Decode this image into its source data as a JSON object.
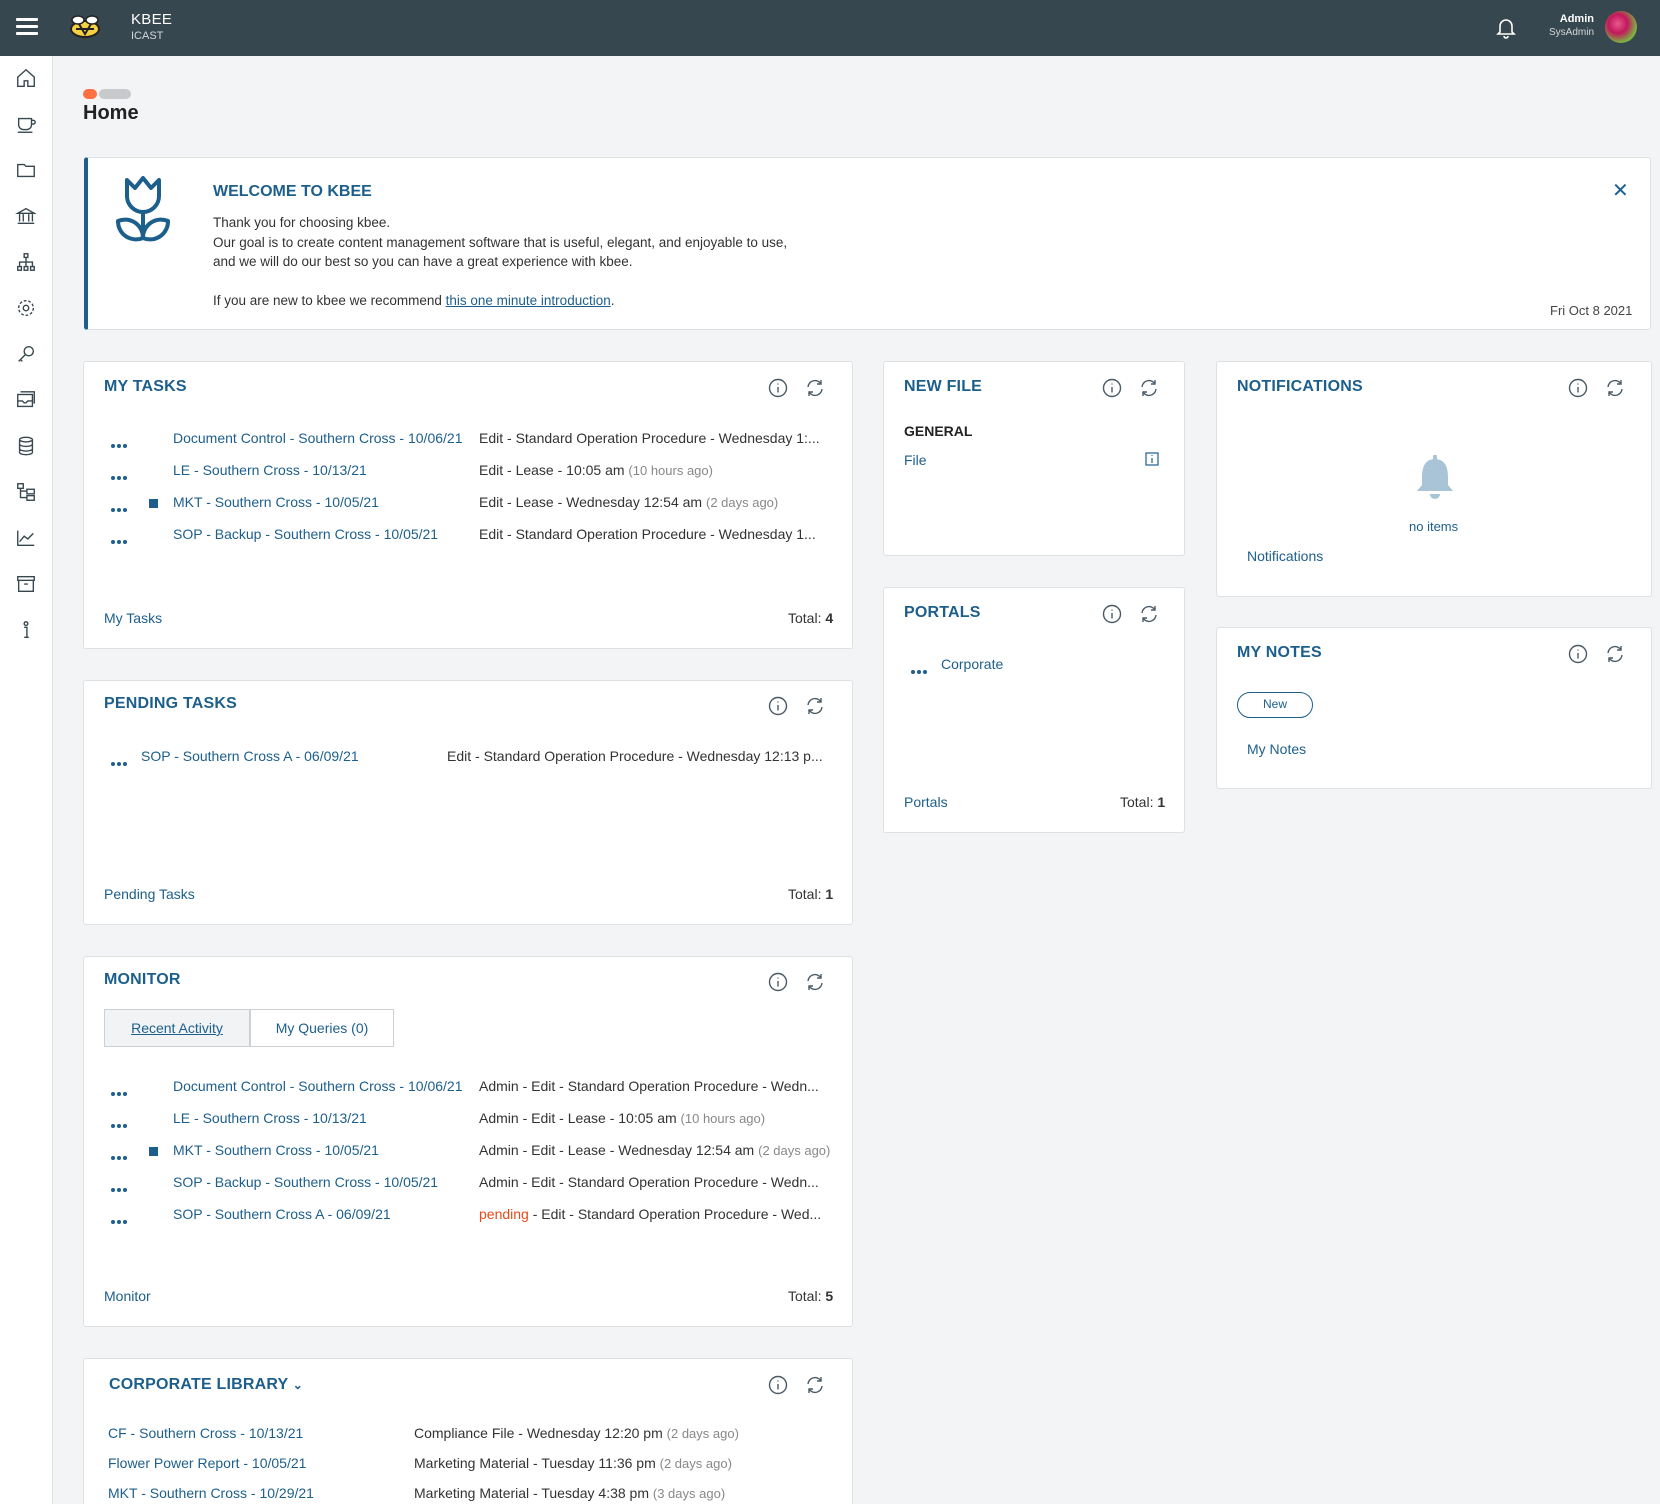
{
  "topbar": {
    "brand_name": "KBEE",
    "brand_sub": "ICAST",
    "user_name": "Admin",
    "user_role": "SysAdmin"
  },
  "page": {
    "title": "Home"
  },
  "welcome": {
    "title": "WELCOME TO KBEE",
    "line1": "Thank you for choosing kbee.",
    "line2": "Our goal is to create content management software that is useful, elegant, and enjoyable to use,",
    "line3": "and we will do our best so you can have a great experience with kbee.",
    "line4_prefix": "If you are new to kbee we recommend ",
    "line4_link": "this one minute introduction",
    "line4_suffix": ".",
    "date": "Fri Oct 8 2021"
  },
  "my_tasks": {
    "title": "MY TASKS",
    "rows": [
      {
        "name": "Document Control - Southern Cross - 10/06/21",
        "desc": "Edit - Standard Operation Procedure - Wednesday 1:...",
        "muted": ""
      },
      {
        "name": "LE - Southern Cross - 10/13/21",
        "desc": "Edit - Lease - 10:05 am ",
        "muted": "(10 hours ago)"
      },
      {
        "name": "MKT - Southern Cross - 10/05/21",
        "desc": "Edit - Lease - Wednesday 12:54 am ",
        "muted": "(2 days ago)"
      },
      {
        "name": "SOP - Backup - Southern Cross - 10/05/21",
        "desc": "Edit - Standard Operation Procedure - Wednesday 1...",
        "muted": ""
      }
    ],
    "footer": "My Tasks",
    "total_label": "Total: ",
    "total": "4"
  },
  "pending_tasks": {
    "title": "PENDING TASKS",
    "rows": [
      {
        "name": "SOP - Southern Cross A - 06/09/21",
        "desc": "Edit - Standard Operation Procedure - Wednesday 12:13 p..."
      }
    ],
    "footer": "Pending Tasks",
    "total_label": "Total: ",
    "total": "1"
  },
  "monitor": {
    "title": "MONITOR",
    "tab_recent": "Recent Activity",
    "tab_queries": "My Queries (0)",
    "rows": [
      {
        "name": "Document Control - Southern Cross - 10/06/21",
        "prefix": "",
        "desc": "Admin - Edit - Standard Operation Procedure - Wedn...",
        "muted": ""
      },
      {
        "name": "LE - Southern Cross - 10/13/21",
        "prefix": "",
        "desc": "Admin - Edit - Lease - 10:05 am ",
        "muted": "(10 hours ago)"
      },
      {
        "name": "MKT - Southern Cross - 10/05/21",
        "prefix": "",
        "desc": "Admin - Edit - Lease - Wednesday 12:54 am ",
        "muted": "(2 days ago)"
      },
      {
        "name": "SOP - Backup - Southern Cross - 10/05/21",
        "prefix": "",
        "desc": "Admin - Edit - Standard Operation Procedure - Wedn...",
        "muted": ""
      },
      {
        "name": "SOP - Southern Cross A - 06/09/21",
        "prefix": "pending",
        "desc": " - Edit - Standard Operation Procedure - Wed...",
        "muted": ""
      }
    ],
    "footer": "Monitor",
    "total_label": "Total: ",
    "total": "5"
  },
  "corporate_library": {
    "title": "CORPORATE LIBRARY",
    "rows": [
      {
        "name": "CF - Southern Cross - 10/13/21",
        "desc": "Compliance File - Wednesday 12:20 pm ",
        "muted": "(2 days ago)"
      },
      {
        "name": "Flower Power Report - 10/05/21",
        "desc": "Marketing Material - Tuesday 11:36 pm ",
        "muted": "(2 days ago)"
      },
      {
        "name": "MKT - Southern Cross - 10/29/21",
        "desc": "Marketing Material - Tuesday 4:38 pm ",
        "muted": "(3 days ago)"
      }
    ]
  },
  "new_file": {
    "title": "NEW FILE",
    "section": "GENERAL",
    "item": "File"
  },
  "portals": {
    "title": "PORTALS",
    "item": "Corporate",
    "footer": "Portals",
    "total_label": "Total: ",
    "total": "1"
  },
  "notifications": {
    "title": "NOTIFICATIONS",
    "empty": "no items",
    "footer": "Notifications"
  },
  "my_notes": {
    "title": "MY NOTES",
    "new_label": "New",
    "footer": "My Notes"
  },
  "colors": {
    "accent": "#1d5f8c",
    "topbar": "#37474f",
    "pending": "#e64a19"
  }
}
